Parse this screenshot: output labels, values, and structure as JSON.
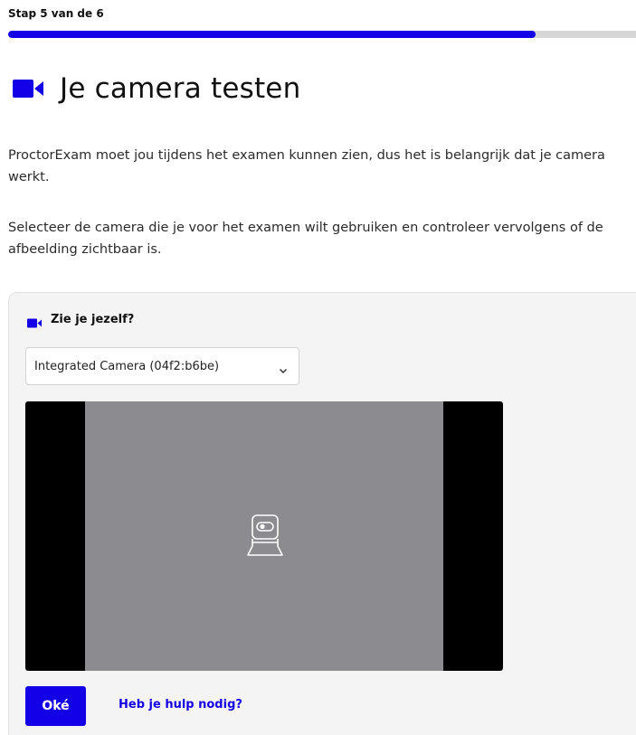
{
  "progress": {
    "label": "Stap 5 van de 6",
    "fraction": 0.84
  },
  "header": {
    "icon": "video-camera-icon",
    "title": "Je camera testen"
  },
  "intro": {
    "paragraph1": "ProctorExam moet jou tijdens het examen kunnen zien, dus het is belangrijk dat je camera werkt.",
    "paragraph2": "Selecteer de camera die je voor het examen wilt gebruiken en controleer vervolgens of de afbeelding zichtbaar is."
  },
  "camera_check": {
    "heading_icon": "video-camera-icon",
    "heading": "Zie je jezelf?",
    "select": {
      "selected": "Integrated Camera (04f2:b6be)",
      "icon": "chevron-down-icon"
    },
    "preview_icon": "webcam-icon",
    "ok_label": "Oké",
    "help_label": "Heb je hulp nodig?"
  },
  "colors": {
    "accent": "#1400e6",
    "progress_track": "#d6d6d6",
    "card_background": "#f4f4f4",
    "video_background": "#000000",
    "video_feed": "#8c8b90"
  }
}
